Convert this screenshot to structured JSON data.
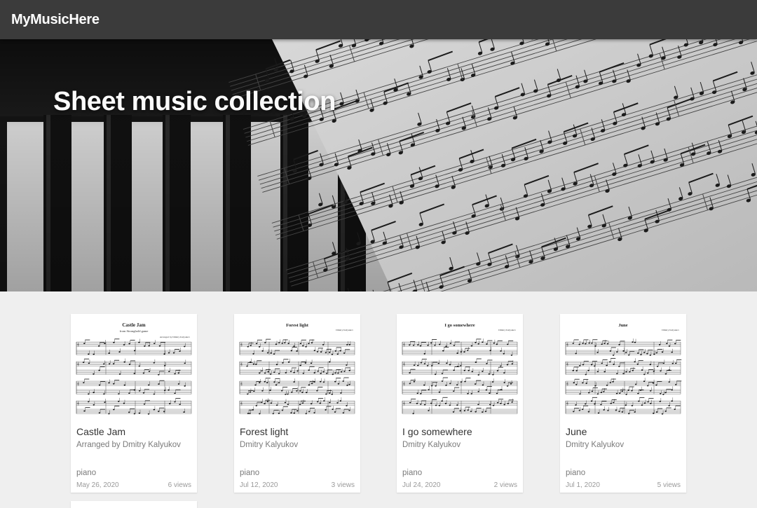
{
  "header": {
    "brand": "MyMusicHere"
  },
  "hero": {
    "title": "Sheet music collection"
  },
  "cards": [
    {
      "title": "Castle Jam",
      "author": "Arranged by Dmitry Kalyukov",
      "tag": "piano",
      "date": "May 26, 2020",
      "views": "6 views",
      "sheet": {
        "title": "Castle Jam",
        "subtitle": "from Stronghold game",
        "credit": "Arranged by Dmitry Kalyukov"
      }
    },
    {
      "title": "Forest light",
      "author": "Dmitry Kalyukov",
      "tag": "piano",
      "date": "Jul 12, 2020",
      "views": "3 views",
      "sheet": {
        "title": "Forest light",
        "subtitle": "",
        "credit": "Dmitry Kalyukov"
      }
    },
    {
      "title": "I go somewhere",
      "author": "Dmitry Kalyukov",
      "tag": "piano",
      "date": "Jul 24, 2020",
      "views": "2 views",
      "sheet": {
        "title": "I go somewhere",
        "subtitle": "",
        "credit": "Dmitry Kalyukov"
      }
    },
    {
      "title": "June",
      "author": "Dmitry Kalyukov",
      "tag": "piano",
      "date": "Jul 1, 2020",
      "views": "5 views",
      "sheet": {
        "title": "June",
        "subtitle": "",
        "credit": "Dmitry Kalyukov"
      }
    }
  ],
  "colors": {
    "header_bg": "#3b3b3b",
    "page_bg": "#efefef",
    "card_bg": "#ffffff"
  }
}
